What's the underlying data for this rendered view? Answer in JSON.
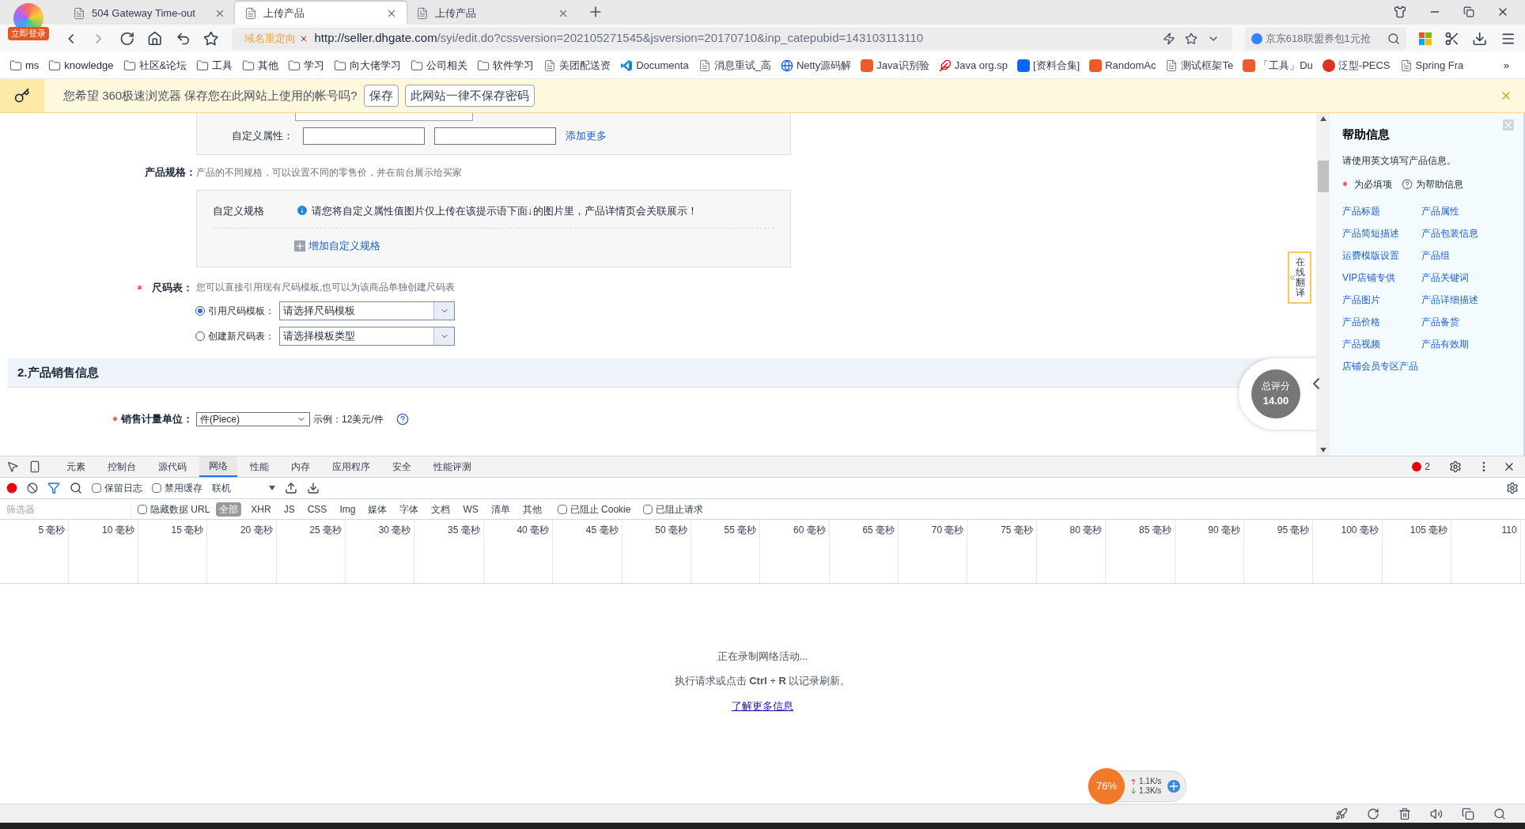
{
  "browser": {
    "login_badge": "立即登录",
    "tabs": [
      {
        "title": "504 Gateway Time-out",
        "selected": false
      },
      {
        "title": "上传产品",
        "selected": true
      },
      {
        "title": "上传产品",
        "selected": false
      }
    ],
    "address": {
      "redirect_label": "域名重定向",
      "url_host": "http://seller.dhgate.com",
      "url_path": "/syi/edit.do?cssversion=202105271545&jsversion=20170710&inp_catepubid=143103113110"
    },
    "search": {
      "placeholder": "京东618联盟券包1元抢"
    },
    "bookmarks": [
      {
        "label": "ms",
        "kind": "folder"
      },
      {
        "label": "knowledge",
        "kind": "folder"
      },
      {
        "label": "社区&论坛",
        "kind": "folder"
      },
      {
        "label": "工具",
        "kind": "folder"
      },
      {
        "label": "其他",
        "kind": "folder"
      },
      {
        "label": "学习",
        "kind": "folder"
      },
      {
        "label": "向大佬学习",
        "kind": "folder"
      },
      {
        "label": "公司相关",
        "kind": "folder"
      },
      {
        "label": "软件学习",
        "kind": "folder"
      },
      {
        "label": "美团配送资",
        "kind": "page"
      },
      {
        "label": "Documenta",
        "kind": "vscode"
      },
      {
        "label": "消息重试_高",
        "kind": "page"
      },
      {
        "label": "Netty源码解",
        "kind": "globe"
      },
      {
        "label": "Java识别验",
        "kind": "csdn"
      },
      {
        "label": "Java org.sp",
        "kind": "feather"
      },
      {
        "label": "[资料合集]",
        "kind": "zhihu"
      },
      {
        "label": "RandomAc",
        "kind": "csdn"
      },
      {
        "label": "测试框架Te",
        "kind": "page"
      },
      {
        "label": "「工具」Du",
        "kind": "csdn"
      },
      {
        "label": "泛型-PECS",
        "kind": "cnblogs"
      },
      {
        "label": "Spring Fra",
        "kind": "page"
      }
    ],
    "bookmarks_overflow": "»"
  },
  "password_bar": {
    "message": "您希望 360极速浏览器 保存您在此网站上使用的帐号吗?",
    "buttons": [
      "保存",
      "此网站一律不保存密码"
    ]
  },
  "form": {
    "custom_attr": {
      "label": "自定义属性：",
      "link": "添加更多"
    },
    "spec": {
      "label": "产品规格：",
      "hint": "产品的不同规格，可以设置不同的零售价，并在前台展示给买家",
      "box_label": "自定义规格",
      "info": "请您将自定义属性值图片仅上传在该提示语下面↓的图片里，产品详情页会关联展示！",
      "add_link": "增加自定义规格"
    },
    "size_chart": {
      "required": true,
      "label": "尺码表：",
      "hint": "您可以直接引用现有尺码模板,也可以为该商品单独创建尺码表",
      "options": [
        {
          "label": "引用尺码模板：",
          "selected": true,
          "select": "请选择尺码模板"
        },
        {
          "label": "创建新尺码表：",
          "selected": false,
          "select": "请选择模板类型"
        }
      ]
    },
    "section_title": "2.产品销售信息",
    "unit": {
      "required": true,
      "label": "销售计量单位：",
      "value": "件(Piece)",
      "example": "示例：12美元/件"
    }
  },
  "translate_tab": "在线翻译",
  "score": {
    "label": "总评分",
    "value": "14.00"
  },
  "help": {
    "title": "帮助信息",
    "intro": "请使用英文填写产品信息。",
    "legend_required": "为必填项",
    "legend_help": "为帮助信息",
    "links": [
      "产品标题",
      "产品属性",
      "产品简短描述",
      "产品包装信息",
      "运费模版设置",
      "产品组",
      "VIP店铺专供",
      "产品关键词",
      "产品图片",
      "产品详细描述",
      "产品价格",
      "产品备货",
      "产品视频",
      "产品有效期",
      "店铺会员专区产品"
    ]
  },
  "devtools": {
    "tabs": [
      {
        "label": "元素",
        "selected": false
      },
      {
        "label": "控制台",
        "selected": false
      },
      {
        "label": "源代码",
        "selected": false
      },
      {
        "label": "网络",
        "selected": true
      },
      {
        "label": "性能",
        "selected": false
      },
      {
        "label": "内存",
        "selected": false
      },
      {
        "label": "应用程序",
        "selected": false
      },
      {
        "label": "安全",
        "selected": false
      },
      {
        "label": "性能评测",
        "selected": false
      }
    ],
    "error_count": "2",
    "options": [
      {
        "label": "保留日志",
        "checked": false
      },
      {
        "label": "禁用缓存",
        "checked": false
      }
    ],
    "throttle": "联机",
    "filter": {
      "placeholder": "筛选器"
    },
    "hide_data_urls": {
      "label": "隐藏数据 URL",
      "checked": false
    },
    "types": [
      {
        "label": "全部",
        "selected": true
      },
      {
        "label": "XHR",
        "selected": false
      },
      {
        "label": "JS",
        "selected": false
      },
      {
        "label": "CSS",
        "selected": false
      },
      {
        "label": "Img",
        "selected": false
      },
      {
        "label": "媒体",
        "selected": false
      },
      {
        "label": "字体",
        "selected": false
      },
      {
        "label": "文档",
        "selected": false
      },
      {
        "label": "WS",
        "selected": false
      },
      {
        "label": "清单",
        "selected": false
      },
      {
        "label": "其他",
        "selected": false
      }
    ],
    "blocked": [
      {
        "label": "已阻止 Cookie",
        "checked": false
      },
      {
        "label": "已阻止请求",
        "checked": false
      }
    ],
    "ticks": [
      "5 毫秒",
      "10 毫秒",
      "15 毫秒",
      "20 毫秒",
      "25 毫秒",
      "30 毫秒",
      "35 毫秒",
      "40 毫秒",
      "45 毫秒",
      "50 毫秒",
      "55 毫秒",
      "60 毫秒",
      "65 毫秒",
      "70 毫秒",
      "75 毫秒",
      "80 毫秒",
      "85 毫秒",
      "90 毫秒",
      "95 毫秒",
      "100 毫秒",
      "105 毫秒",
      "110"
    ],
    "empty": {
      "recording": "正在录制网络活动...",
      "hint": "执行请求或点击 **Ctrl** + **R** 以记录刷新。",
      "link": "了解更多信息"
    }
  },
  "net_widget": {
    "percent": "76%",
    "up": "1.1K/s",
    "down": "1.3K/s"
  }
}
